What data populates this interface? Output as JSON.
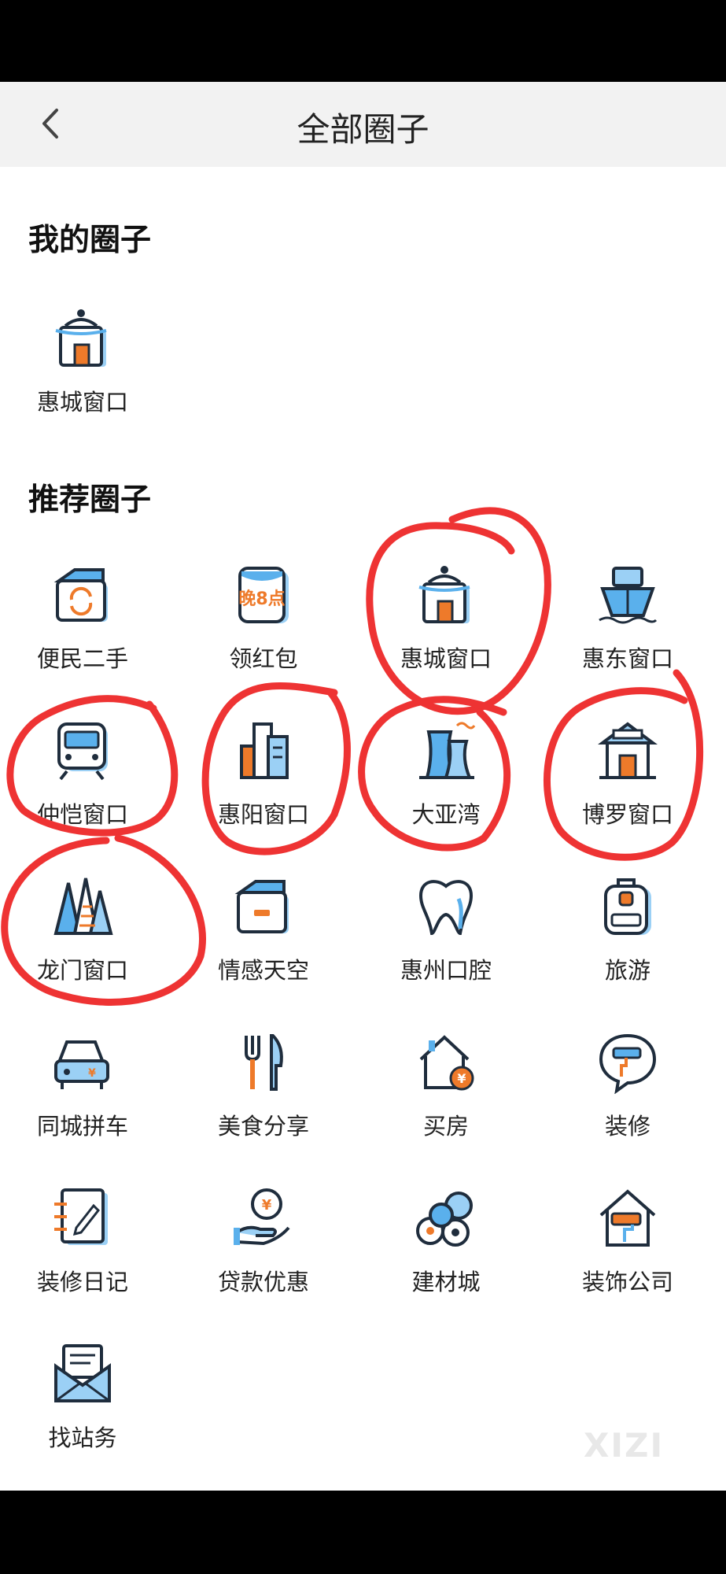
{
  "header": {
    "title": "全部圈子"
  },
  "my_section": {
    "title": "我的圈子",
    "items": [
      {
        "label": "惠城窗口",
        "icon": "pot-window-icon"
      }
    ]
  },
  "rec_section": {
    "title": "推荐圈子",
    "items": [
      {
        "label": "便民二手",
        "icon": "recycle-box-icon"
      },
      {
        "label": "领红包",
        "icon": "red-packet-icon",
        "icon_text": "晚8点"
      },
      {
        "label": "惠城窗口",
        "icon": "pot-window-icon"
      },
      {
        "label": "惠东窗口",
        "icon": "ship-icon"
      },
      {
        "label": "仲恺窗口",
        "icon": "train-icon"
      },
      {
        "label": "惠阳窗口",
        "icon": "buildings-icon"
      },
      {
        "label": "大亚湾",
        "icon": "power-plant-icon"
      },
      {
        "label": "博罗窗口",
        "icon": "temple-icon"
      },
      {
        "label": "龙门窗口",
        "icon": "mountain-icon"
      },
      {
        "label": "情感天空",
        "icon": "box-icon"
      },
      {
        "label": "惠州口腔",
        "icon": "tooth-icon"
      },
      {
        "label": "旅游",
        "icon": "backpack-icon"
      },
      {
        "label": "同城拼车",
        "icon": "car-icon"
      },
      {
        "label": "美食分享",
        "icon": "fork-knife-icon"
      },
      {
        "label": "买房",
        "icon": "house-icon"
      },
      {
        "label": "装修",
        "icon": "paint-roller-chat-icon"
      },
      {
        "label": "装修日记",
        "icon": "notebook-pen-icon"
      },
      {
        "label": "贷款优惠",
        "icon": "loan-coin-icon"
      },
      {
        "label": "建材城",
        "icon": "pipes-icon"
      },
      {
        "label": "装饰公司",
        "icon": "house-roller-icon"
      },
      {
        "label": "找站务",
        "icon": "mail-icon"
      }
    ]
  },
  "watermark": "XIZI",
  "colors": {
    "accent": "#ee7a2a",
    "blue": "#5ab0ec",
    "stroke": "#1f2d3d",
    "annotation": "#ee3333"
  }
}
